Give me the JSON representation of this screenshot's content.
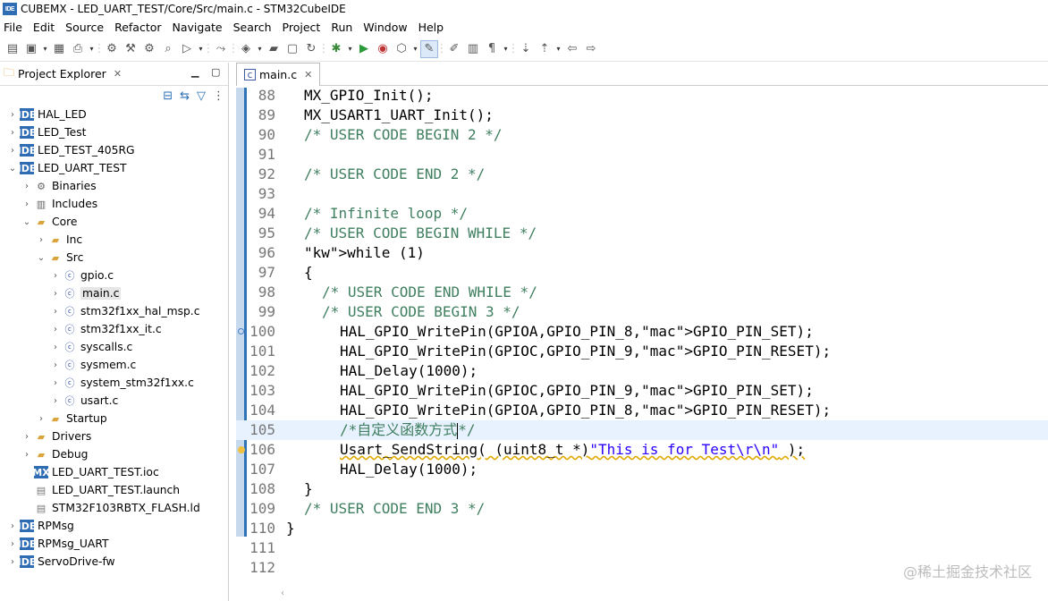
{
  "titlebar": {
    "badge": "IDE",
    "title": "CUBEMX - LED_UART_TEST/Core/Src/main.c - STM32CubeIDE"
  },
  "menubar": [
    "File",
    "Edit",
    "Source",
    "Refactor",
    "Navigate",
    "Search",
    "Project",
    "Run",
    "Window",
    "Help"
  ],
  "toolbar": {
    "icons": [
      "new-icon",
      "save-icon",
      "save-all-icon",
      "print-icon",
      "build-icon",
      "hammer-icon",
      "debug-config-icon",
      "search-icon",
      "run-ext-icon",
      "step-icon",
      "new-class-icon",
      "new-folder-icon",
      "new-file-icon",
      "refresh-icon",
      "bug-icon",
      "run-icon",
      "external-tools-icon",
      "open-type-icon",
      "pen-icon",
      "highlight-icon",
      "open-task-icon",
      "pilcrow-icon",
      "nav-next-icon",
      "nav-prev-icon",
      "back-icon",
      "forward-icon"
    ]
  },
  "explorer": {
    "tab_label": "Project Explorer",
    "tab_close": "✕",
    "tree": [
      {
        "label": "HAL_LED",
        "depth": 0,
        "kind": "project",
        "expanded": false
      },
      {
        "label": "LED_Test",
        "depth": 0,
        "kind": "project",
        "expanded": false
      },
      {
        "label": "LED_TEST_405RG",
        "depth": 0,
        "kind": "project",
        "expanded": false
      },
      {
        "label": "LED_UART_TEST",
        "depth": 0,
        "kind": "project",
        "expanded": true
      },
      {
        "label": "Binaries",
        "depth": 1,
        "kind": "binaries",
        "expanded": false
      },
      {
        "label": "Includes",
        "depth": 1,
        "kind": "includes",
        "expanded": false
      },
      {
        "label": "Core",
        "depth": 1,
        "kind": "folder",
        "expanded": true
      },
      {
        "label": "Inc",
        "depth": 2,
        "kind": "folder",
        "expanded": false
      },
      {
        "label": "Src",
        "depth": 2,
        "kind": "folder",
        "expanded": true
      },
      {
        "label": "gpio.c",
        "depth": 3,
        "kind": "file",
        "expanded": false
      },
      {
        "label": "main.c",
        "depth": 3,
        "kind": "file-warn",
        "expanded": false,
        "selected": true
      },
      {
        "label": "stm32f1xx_hal_msp.c",
        "depth": 3,
        "kind": "file",
        "expanded": false
      },
      {
        "label": "stm32f1xx_it.c",
        "depth": 3,
        "kind": "file",
        "expanded": false
      },
      {
        "label": "syscalls.c",
        "depth": 3,
        "kind": "file",
        "expanded": false
      },
      {
        "label": "sysmem.c",
        "depth": 3,
        "kind": "file",
        "expanded": false
      },
      {
        "label": "system_stm32f1xx.c",
        "depth": 3,
        "kind": "file",
        "expanded": false
      },
      {
        "label": "usart.c",
        "depth": 3,
        "kind": "file",
        "expanded": false
      },
      {
        "label": "Startup",
        "depth": 2,
        "kind": "folder",
        "expanded": false
      },
      {
        "label": "Drivers",
        "depth": 1,
        "kind": "folder",
        "expanded": false
      },
      {
        "label": "Debug",
        "depth": 1,
        "kind": "folder",
        "expanded": false
      },
      {
        "label": "LED_UART_TEST.ioc",
        "depth": 1,
        "kind": "ioc",
        "leaf": true
      },
      {
        "label": "LED_UART_TEST.launch",
        "depth": 1,
        "kind": "launch",
        "leaf": true
      },
      {
        "label": "STM32F103RBTX_FLASH.ld",
        "depth": 1,
        "kind": "ld",
        "leaf": true
      },
      {
        "label": "RPMsg",
        "depth": 0,
        "kind": "project",
        "expanded": false
      },
      {
        "label": "RPMsg_UART",
        "depth": 0,
        "kind": "project",
        "expanded": false
      },
      {
        "label": "ServoDrive-fw",
        "depth": 0,
        "kind": "project",
        "expanded": false
      }
    ]
  },
  "editor": {
    "tab_label": "main.c",
    "tab_close": "✕",
    "lines": [
      {
        "n": "88",
        "code": "MX_GPIO_Init();"
      },
      {
        "n": "89",
        "code": "MX_USART1_UART_Init();"
      },
      {
        "n": "90",
        "code": "/* USER CODE BEGIN 2 */"
      },
      {
        "n": "91",
        "code": ""
      },
      {
        "n": "92",
        "code": "/* USER CODE END 2 */"
      },
      {
        "n": "93",
        "code": ""
      },
      {
        "n": "94",
        "code": "/* Infinite loop */"
      },
      {
        "n": "95",
        "code": "/* USER CODE BEGIN WHILE */"
      },
      {
        "n": "96",
        "code": "while (1)"
      },
      {
        "n": "97",
        "code": "{"
      },
      {
        "n": "98",
        "code": "/* USER CODE END WHILE */"
      },
      {
        "n": "99",
        "code": "/* USER CODE BEGIN 3 */"
      },
      {
        "n": "100",
        "code": "HAL_GPIO_WritePin(GPIOA,GPIO_PIN_8,GPIO_PIN_SET);"
      },
      {
        "n": "101",
        "code": "HAL_GPIO_WritePin(GPIOC,GPIO_PIN_9,GPIO_PIN_RESET);"
      },
      {
        "n": "102",
        "code": "HAL_Delay(1000);"
      },
      {
        "n": "103",
        "code": "HAL_GPIO_WritePin(GPIOC,GPIO_PIN_9,GPIO_PIN_SET);"
      },
      {
        "n": "104",
        "code": "HAL_GPIO_WritePin(GPIOA,GPIO_PIN_8,GPIO_PIN_RESET);"
      },
      {
        "n": "105",
        "code": "/*自定义函数方式*/"
      },
      {
        "n": "106",
        "code": "Usart_SendString( (uint8_t *)\"This is for Test\\r\\n\" );"
      },
      {
        "n": "107",
        "code": "HAL_Delay(1000);"
      },
      {
        "n": "108",
        "code": "}"
      },
      {
        "n": "109",
        "code": "/* USER CODE END 3 */"
      },
      {
        "n": "110",
        "code": "}"
      },
      {
        "n": "111",
        "code": ""
      },
      {
        "n": "112",
        "code": ""
      }
    ]
  },
  "watermark": "@稀土掘金技术社区",
  "colors": {
    "keyword": "#7f0055",
    "comment": "#3f7f5f",
    "string": "#2a00ff",
    "macro": "#0000c0",
    "accent": "#2e73b8"
  }
}
